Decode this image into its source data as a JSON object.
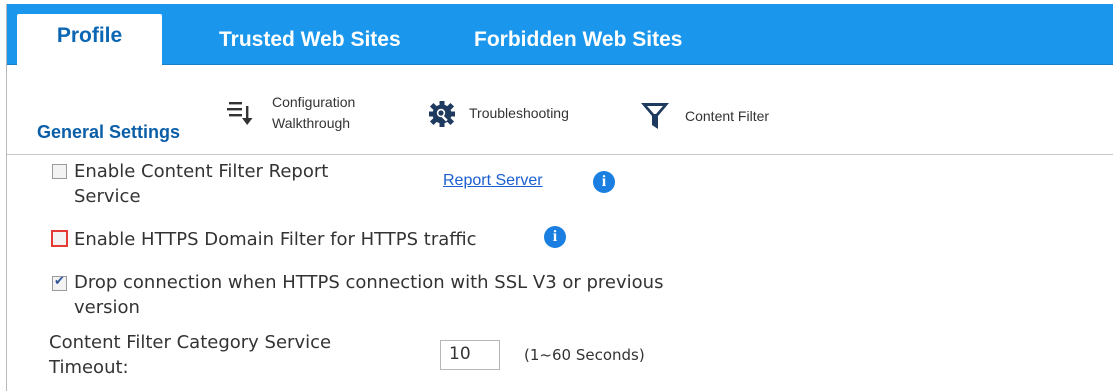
{
  "tabs": [
    {
      "label": "Profile",
      "active": true
    },
    {
      "label": "Trusted Web Sites",
      "active": false
    },
    {
      "label": "Forbidden Web Sites",
      "active": false
    }
  ],
  "toolbar": {
    "config_line1": "Configuration",
    "config_line2": "Walkthrough",
    "troubleshooting": "Troubleshooting",
    "content_filter": "Content Filter"
  },
  "section": {
    "title": "General Settings"
  },
  "settings": {
    "report_service_line1": "Enable Content Filter Report",
    "report_service_line2": "Service",
    "report_service_checked": false,
    "report_server_link": "Report Server",
    "https_domain_filter": "Enable HTTPS Domain Filter for HTTPS traffic",
    "https_domain_filter_checked": false,
    "drop_connection_line1": "Drop connection when HTTPS connection with SSL V3 or previous",
    "drop_connection_line2": "version",
    "drop_connection_checked": true,
    "timeout_label_line1": "Content Filter Category Service",
    "timeout_label_line2": "Timeout:",
    "timeout_value": "10",
    "timeout_hint": "(1~60 Seconds)"
  },
  "colors": {
    "tabbar": "#1a97ec",
    "active_tab_text": "#0b67b3",
    "section_title": "#0b5fa8",
    "info_icon": "#1a7fe0",
    "highlight_border": "#e53935"
  }
}
